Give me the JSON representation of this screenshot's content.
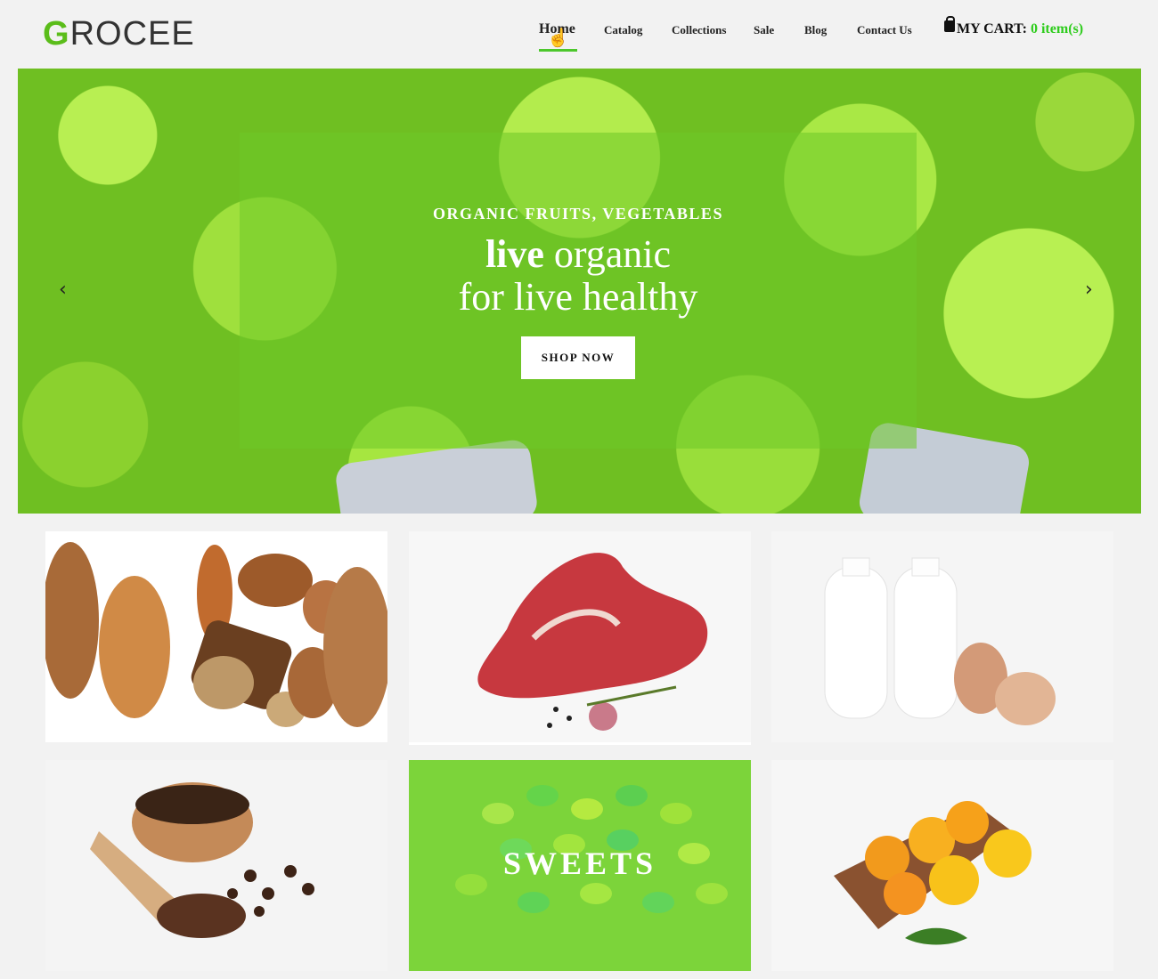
{
  "brand": {
    "logo_first": "G",
    "logo_rest": "ROCEE"
  },
  "nav": {
    "items": [
      "Home",
      "Catalog",
      "Collections",
      "Sale",
      "Blog",
      "Contact Us"
    ],
    "active": "Home"
  },
  "cart": {
    "label": "MY CART:",
    "count": "0 item(s)",
    "icon": "shopping-bag-icon"
  },
  "hero": {
    "kicker": "ORGANIC FRUITS, VEGETABLES",
    "title_bold": "live",
    "title_rest": "organic",
    "subtitle": "for live healthy",
    "button": "SHOP NOW",
    "prev_icon": "chevron-left-icon",
    "next_icon": "chevron-right-icon"
  },
  "categories": [
    {
      "image": "bread"
    },
    {
      "image": "meat"
    },
    {
      "image": "milk-eggs"
    },
    {
      "image": "coffee"
    },
    {
      "image": "sweets",
      "label": "SWEETS"
    },
    {
      "image": "citrus-fruits"
    }
  ],
  "colors": {
    "accent": "#4cc72c",
    "cart_count": "#2ecc1c",
    "hero_overlay": "#6ec828"
  }
}
